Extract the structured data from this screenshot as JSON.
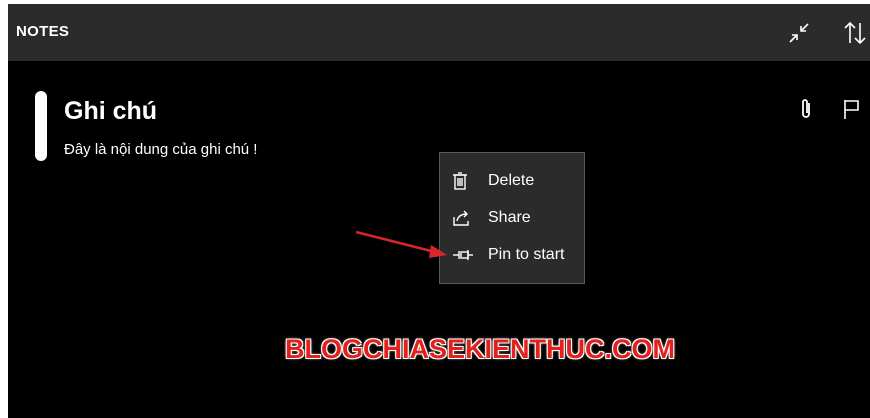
{
  "app": {
    "title": "NOTES"
  },
  "toolbar": {
    "collapse_icon": "collapse-arrows-icon",
    "sort_icon": "sort-arrows-icon"
  },
  "note": {
    "title": "Ghi chú",
    "body": "Đây là nội dung của ghi chú !",
    "attach_icon": "paperclip-icon",
    "flag_icon": "flag-icon"
  },
  "context_menu": {
    "items": [
      {
        "label": "Delete",
        "icon": "trash-icon"
      },
      {
        "label": "Share",
        "icon": "share-icon"
      },
      {
        "label": "Pin to start",
        "icon": "pin-icon"
      }
    ]
  },
  "watermark": "BLOGCHIASEKIENTHUC.COM",
  "colors": {
    "titlebar": "#2b2b2b",
    "background": "#000000",
    "menu": "#2b2b2b",
    "arrow": "#d9262c",
    "watermark": "#e3201b"
  }
}
